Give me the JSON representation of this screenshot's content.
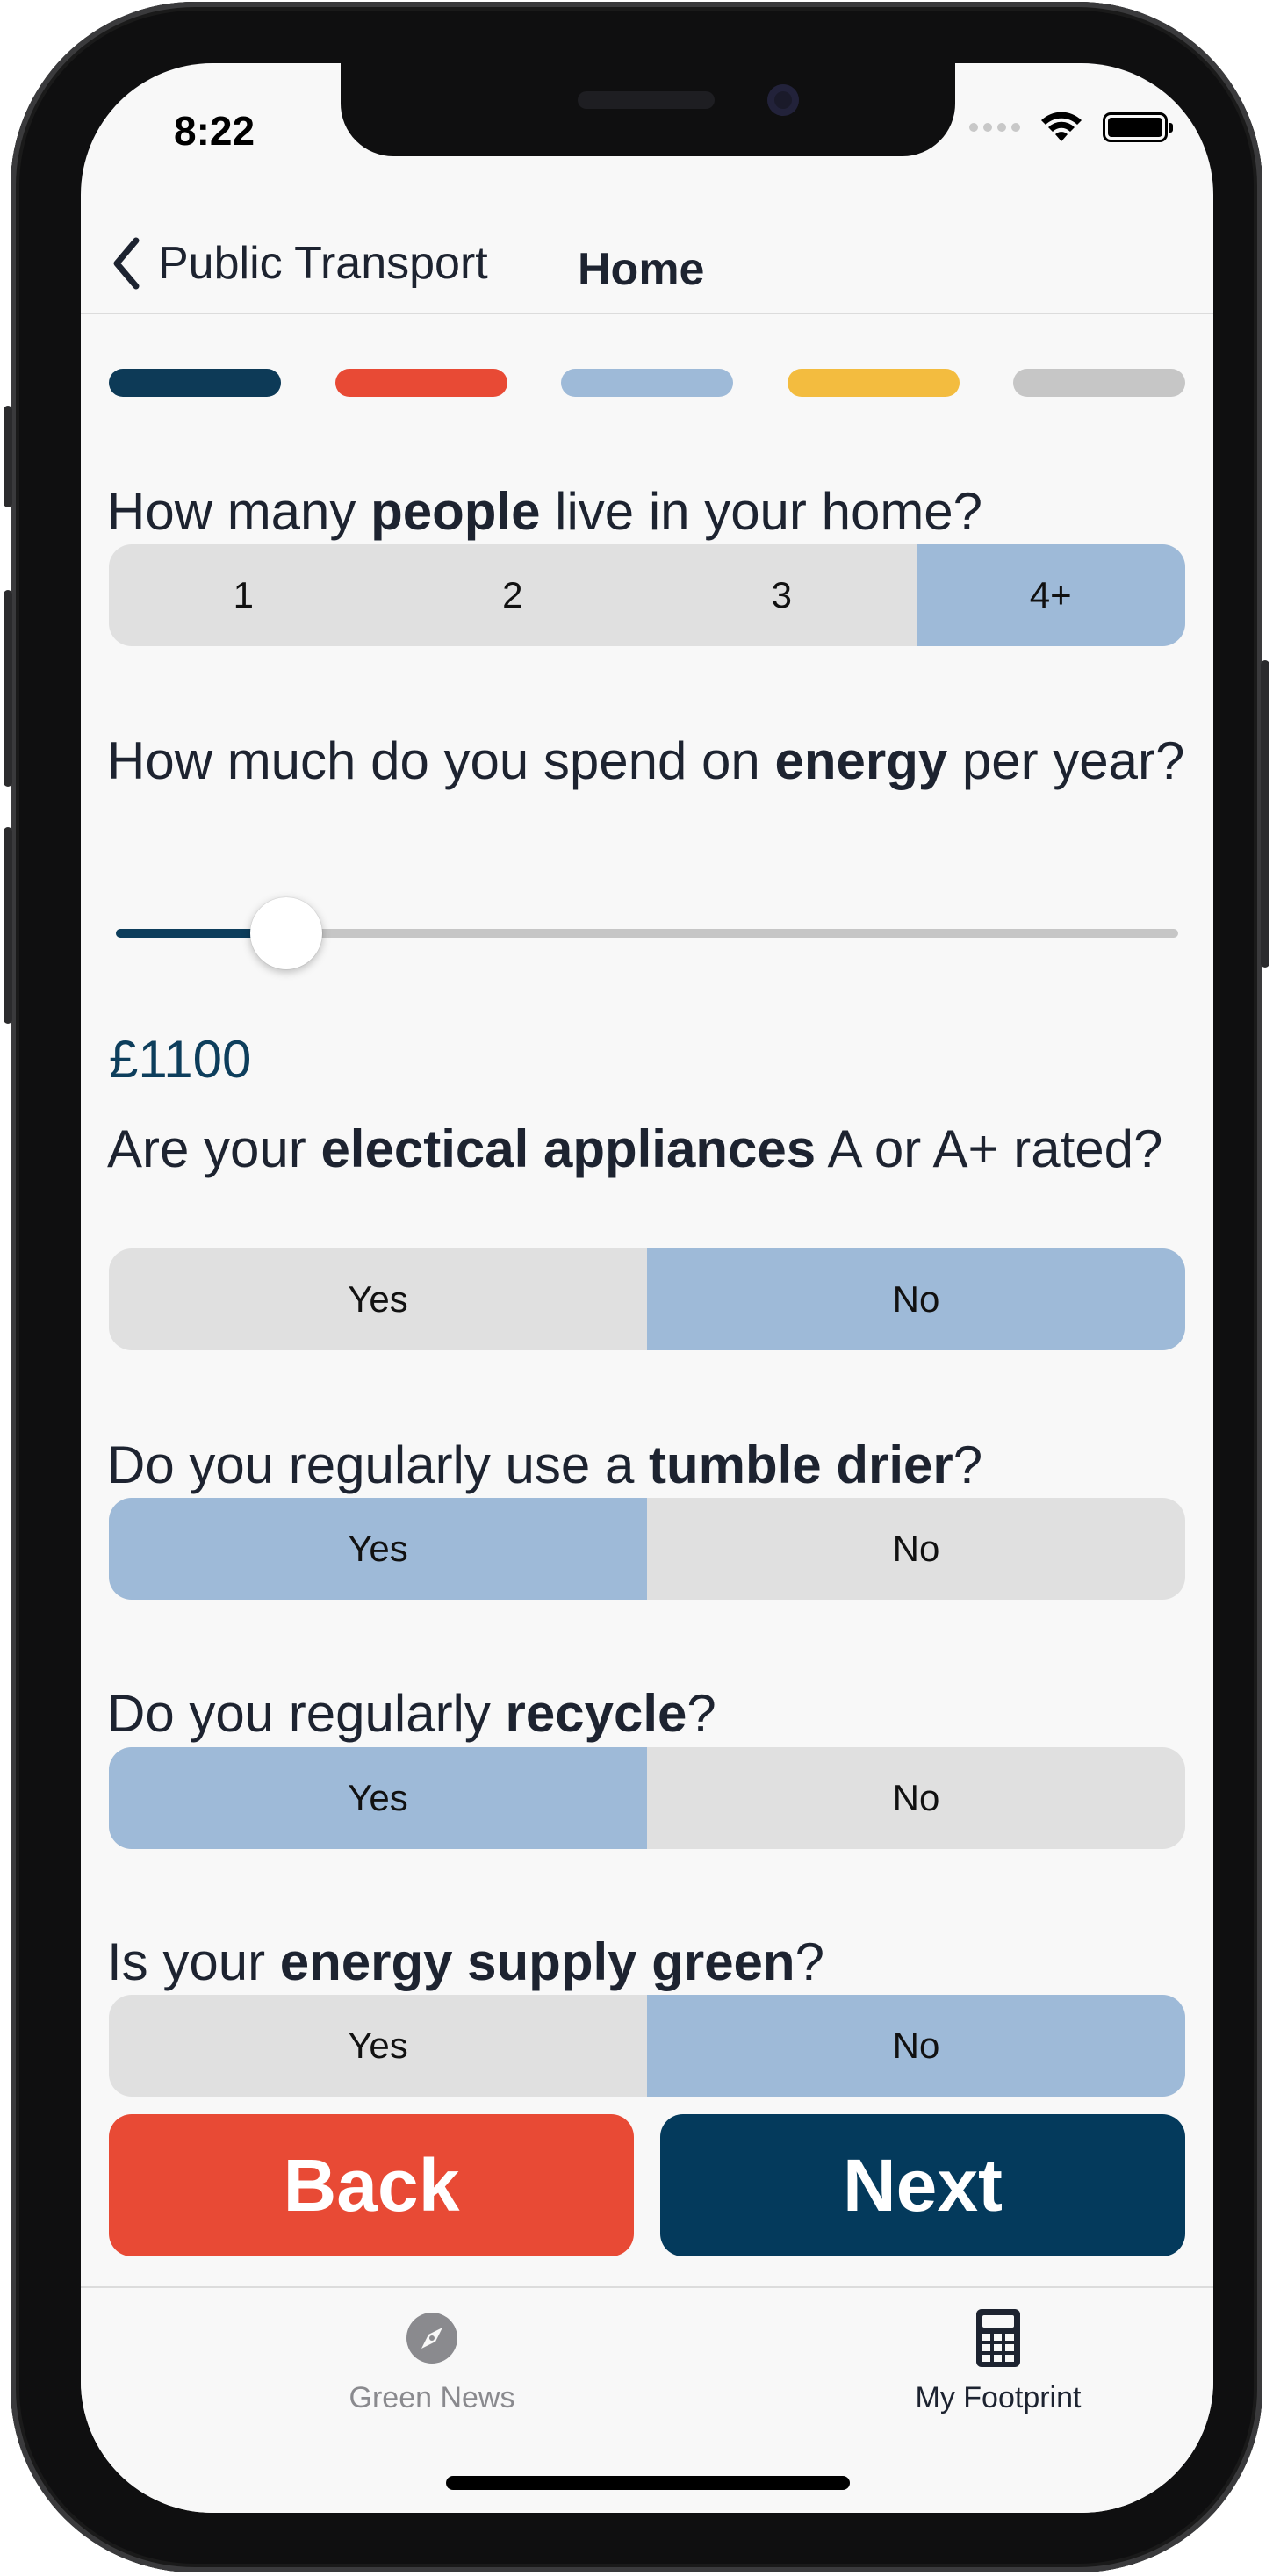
{
  "status_bar": {
    "time": "8:22"
  },
  "nav": {
    "back_label": "Public Transport",
    "title": "Home"
  },
  "progress": {
    "steps": [
      "#0d3a57",
      "#e84a35",
      "#9ebad8",
      "#f3bc3f",
      "#c6c6c6"
    ]
  },
  "questions": {
    "people": {
      "pre": "How many ",
      "bold": "people",
      "post": " live in your home?",
      "options": [
        "1",
        "2",
        "3",
        "4+"
      ],
      "selected": "4+"
    },
    "energy": {
      "pre": "How much do you spend on ",
      "bold": "energy",
      "post": " per year?",
      "value_label": "£1100",
      "slider_fraction": 0.16
    },
    "appliances": {
      "pre": "Are your ",
      "bold": "electical appliances",
      "post": " A or A+ rated?",
      "options": [
        "Yes",
        "No"
      ],
      "selected": "No"
    },
    "tumble": {
      "pre": "Do you regularly use a ",
      "bold": "tumble drier",
      "post": "?",
      "options": [
        "Yes",
        "No"
      ],
      "selected": "Yes"
    },
    "recycle": {
      "pre": "Do you regularly ",
      "bold": "recycle",
      "post": "?",
      "options": [
        "Yes",
        "No"
      ],
      "selected": "Yes"
    },
    "green": {
      "pre": "Is your ",
      "bold": "energy supply green",
      "post": "?",
      "options": [
        "Yes",
        "No"
      ],
      "selected": "No"
    }
  },
  "actions": {
    "back_label": "Back",
    "next_label": "Next"
  },
  "tabs": [
    {
      "label": "Green News",
      "icon": "compass-icon",
      "active": false
    },
    {
      "label": "My Footprint",
      "icon": "calculator-icon",
      "active": true
    }
  ],
  "colors": {
    "accent": "#0d3e5c",
    "selected": "#9ebad8",
    "back": "#e84a35",
    "next": "#043a5c"
  }
}
